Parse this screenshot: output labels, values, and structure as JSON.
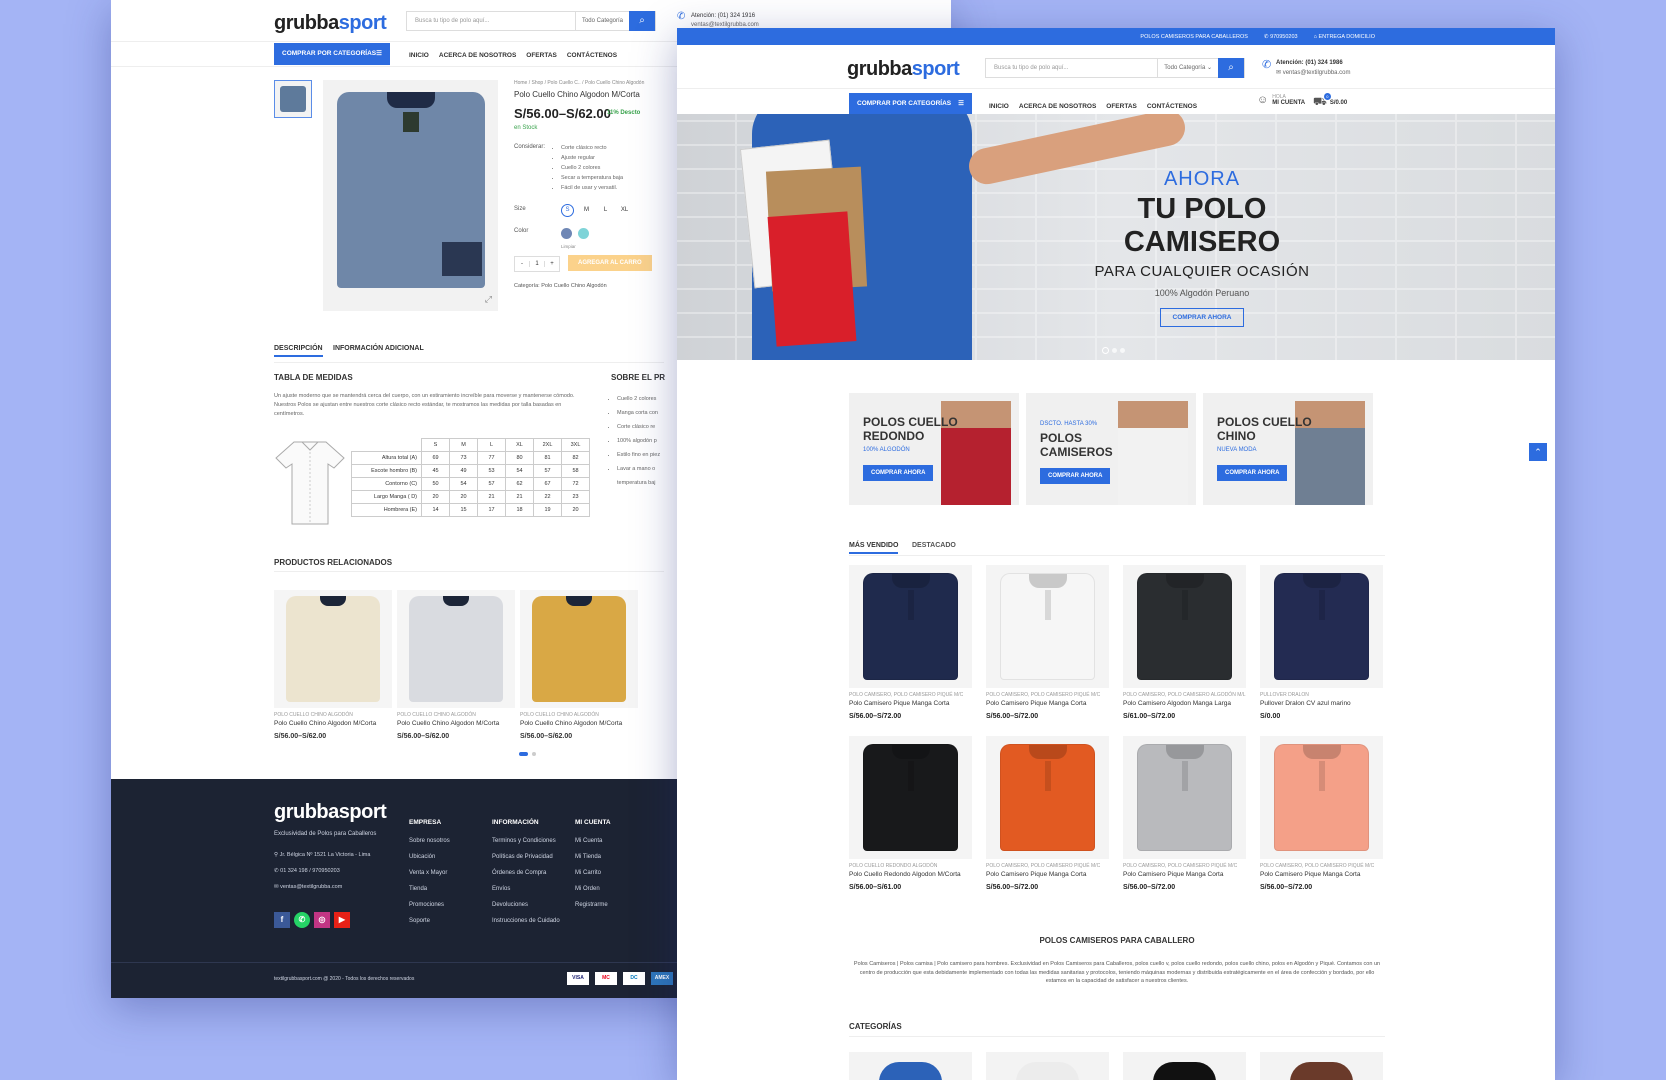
{
  "brand": {
    "a": "grubba",
    "b": "sport"
  },
  "back": {
    "search_placeholder": "Busca tu tipo de polo aquí...",
    "category_select": "Todo Categoría",
    "attention": "Atención: (01) 324 1916",
    "email": "ventas@textilgrubba.com",
    "categories_button": "COMPRAR POR CATEGORÍAS",
    "nav": [
      "INICIO",
      "ACERCA DE NOSOTROS",
      "OFERTAS",
      "CONTÁCTENOS"
    ],
    "breadcrumb": "Home  /  Shop  /  Polo Cuello C..  /  Polo Cuello Chino Algodón",
    "product_title": "Polo Cuello Chino Algodon M/Corta",
    "price": "S/56.00–S/62.00",
    "discount": "11% Descto",
    "stock": "en Stock",
    "consider_label": "Considerar:",
    "features": [
      "Corte clásico recto",
      "Ajuste regular",
      "Cuello 2 colores",
      "Secar a temperatura baja",
      "Fácil de usar y versatil."
    ],
    "size_label": "Size",
    "sizes": [
      "S",
      "M",
      "L",
      "XL"
    ],
    "color_label": "Color",
    "clear": "Limpiar",
    "qty": "1",
    "add_cart": "AGREGAR AL CARRO",
    "category_line": "Categoría: Polo Cuello Chino Algodón",
    "tabs": [
      "DESCRIPCIÓN",
      "INFORMACIÓN ADICIONAL"
    ],
    "measures_title": "TABLA DE MEDIDAS",
    "measures_text": "Un ajuste moderno que se mantendrá cerca del cuerpo, con un estiramiento increíble para moverse y mantenerse cómodo. Nuestros Polos se ajustan entre nuestros corte clásico recto estándar, te mostramos las medidas por talla basadas en centímetros.",
    "about_title": "SOBRE EL PR",
    "about_items": [
      "Cuello 2 colores",
      "Manga corta con",
      "Corte clásico re",
      "100% algodón p",
      "Estilo fino en piez",
      "Lavar a mano o temperatura baj"
    ],
    "size_table": {
      "head": [
        "S",
        "M",
        "L",
        "XL",
        "2XL",
        "3XL"
      ],
      "rows": [
        {
          "label": "Altura total (A)",
          "vals": [
            "69",
            "73",
            "77",
            "80",
            "81",
            "82"
          ]
        },
        {
          "label": "Escote hombro (B)",
          "vals": [
            "45",
            "49",
            "53",
            "54",
            "57",
            "58"
          ]
        },
        {
          "label": "Contorno (C)",
          "vals": [
            "50",
            "54",
            "57",
            "62",
            "67",
            "72"
          ]
        },
        {
          "label": "Largo Manga ( D)",
          "vals": [
            "20",
            "20",
            "21",
            "21",
            "22",
            "23"
          ]
        },
        {
          "label": "Hombrera (E)",
          "vals": [
            "14",
            "15",
            "17",
            "18",
            "19",
            "20"
          ]
        }
      ]
    },
    "related_title": "PRODUCTOS RELACIONADOS",
    "related": [
      {
        "cat": "POLO CUELLO CHINO ALGODÓN",
        "name": "Polo Cuello Chino Algodon M/Corta",
        "price": "S/56.00–S/62.00",
        "color": "#ece4cf"
      },
      {
        "cat": "POLO CUELLO CHINO ALGODÓN",
        "name": "Polo Cuello Chino Algodon M/Corta",
        "price": "S/56.00–S/62.00",
        "color": "#d9dbe0"
      },
      {
        "cat": "POLO CUELLO CHINO ALGODÓN",
        "name": "Polo Cuello Chino Algodon M/Corta",
        "price": "S/56.00–S/62.00",
        "color": "#d9a845"
      }
    ],
    "footer": {
      "tagline": "Exclusividad de Polos para Caballeros",
      "address": "Jr. Bélgica Nº 1521 La Victoria - Lima",
      "phones": "01 324 198 / 970950203",
      "mail": "ventas@textilgrubba.com",
      "cols": [
        {
          "title": "EMPRESA",
          "items": [
            "Sobre nosotros",
            "Ubicación",
            "Venta x Mayor",
            "Tienda",
            "Promociones",
            "Soporte"
          ]
        },
        {
          "title": "INFORMACIÓN",
          "items": [
            "Terminos y Condiciones",
            "Políticas de Privacidad",
            "Órdenes de Compra",
            "Envíos",
            "Devoluciones",
            "Instrucciones de Cuidado"
          ]
        },
        {
          "title": "MI CUENTA",
          "items": [
            "Mi Cuenta",
            "Mi Tienda",
            "Mi Carrito",
            "Mi Orden",
            "Registrarme"
          ]
        }
      ],
      "col4_title": "BO",
      "social": [
        "f",
        "w",
        "ig",
        "yt"
      ],
      "copyright": "textilgrubbasport.com @ 2020 - Todos los derechos reservados",
      "payments": [
        "VISA",
        "MC",
        "DC",
        "AMEX"
      ]
    }
  },
  "front": {
    "topbar": [
      "POLOS CAMISEROS PARA CABALLEROS",
      "970950203",
      "ENTREGA DOMICILIO"
    ],
    "search_placeholder": "Busca tu tipo de polo aquí...",
    "category_select": "Todo Categoría",
    "attention": "Atención: (01) 324 1986",
    "email": "ventas@textilgrubba.com",
    "categories_button": "COMPRAR POR CATEGORÍAS",
    "nav": [
      "INICIO",
      "ACERCA DE NOSOTROS",
      "OFERTAS",
      "CONTÁCTENOS"
    ],
    "account_hello": "HOLA",
    "account": "MI CUENTA",
    "cart_count": "0",
    "cart_total": "S/0.00",
    "hero": {
      "l1": "AHORA",
      "l2": "TU POLO CAMISERO",
      "l3": "PARA CUALQUIER OCASIÓN",
      "l4": "100% Algodón Peruano",
      "cta": "COMPRAR AHORA"
    },
    "promos": [
      {
        "pre": "",
        "title1": "POLOS CUELLO",
        "title2": "REDONDO",
        "sub": "100% ALGODÓN",
        "cta": "COMPRAR AHORA",
        "color": "#b5212f"
      },
      {
        "pre": "DSCTO. HASTA 30%",
        "title1": "POLOS",
        "title2": "CAMISEROS",
        "sub": "",
        "cta": "COMPRAR AHORA",
        "color": "#f2f2f2"
      },
      {
        "pre": "",
        "title1": "POLOS CUELLO",
        "title2": "CHINO",
        "sub": "NUEVA MODA",
        "cta": "COMPRAR AHORA",
        "color": "#6f7f93"
      }
    ],
    "tabs": [
      "MÁS VENDIDO",
      "DESTACADO"
    ],
    "products": [
      {
        "cat": "POLO CAMISERO, POLO CAMISERO PIQUÉ M/C",
        "name": "Polo Camisero Pique Manga Corta",
        "price": "S/56.00–S/72.00",
        "color": "#1f2a4d"
      },
      {
        "cat": "POLO CAMISERO, POLO CAMISERO PIQUÉ M/C",
        "name": "Polo Camisero Pique Manga Corta",
        "price": "S/56.00–S/72.00",
        "color": "#f6f6f6"
      },
      {
        "cat": "POLO CAMISERO, POLO CAMISERO ALGODÓN M/L",
        "name": "Polo Camisero Algodon Manga Larga",
        "price": "S/61.00–S/72.00",
        "color": "#2a2d30"
      },
      {
        "cat": "PULLOVER DRALON",
        "name": "Pullover Dralon CV azul marino",
        "price": "S/0.00",
        "color": "#232b52"
      },
      {
        "cat": "POLO CUELLO REDONDO ALGODÓN",
        "name": "Polo Cuello Redondo Algodon M/Corta",
        "price": "S/56.00–S/61.00",
        "color": "#18191b"
      },
      {
        "cat": "POLO CAMISERO, POLO CAMISERO PIQUÉ M/C",
        "name": "Polo Camisero Pique Manga Corta",
        "price": "S/56.00–S/72.00",
        "color": "#e25a22"
      },
      {
        "cat": "POLO CAMISERO, POLO CAMISERO PIQUÉ M/C",
        "name": "Polo Camisero Pique Manga Corta",
        "price": "S/56.00–S/72.00",
        "color": "#b9babd"
      },
      {
        "cat": "POLO CAMISERO, POLO CAMISERO PIQUÉ M/C",
        "name": "Polo Camisero Pique Manga Corta",
        "price": "S/56.00–S/72.00",
        "color": "#f4a088"
      }
    ],
    "seo_title": "POLOS CAMISEROS PARA CABALLERO",
    "seo_text": "Polos Camiseros | Polos camisa | Polo camisero para hombres. Exclusividad en Polos Camiseros para Caballeros, polos cuello v, polos cuello redondo, polos cuello chino, polos en Algodón y Piqué. Contamos con un centro de producción que esta debidamente implementado con todas las medidas sanitarias y protocolos, teniendo máquinas modernas y distribuida estratégicamente en el área de confección y bordado, por ello estamos en la capacidad de satisfacer a nuestros clientes.",
    "categories_title": "CATEGORÍAS"
  }
}
